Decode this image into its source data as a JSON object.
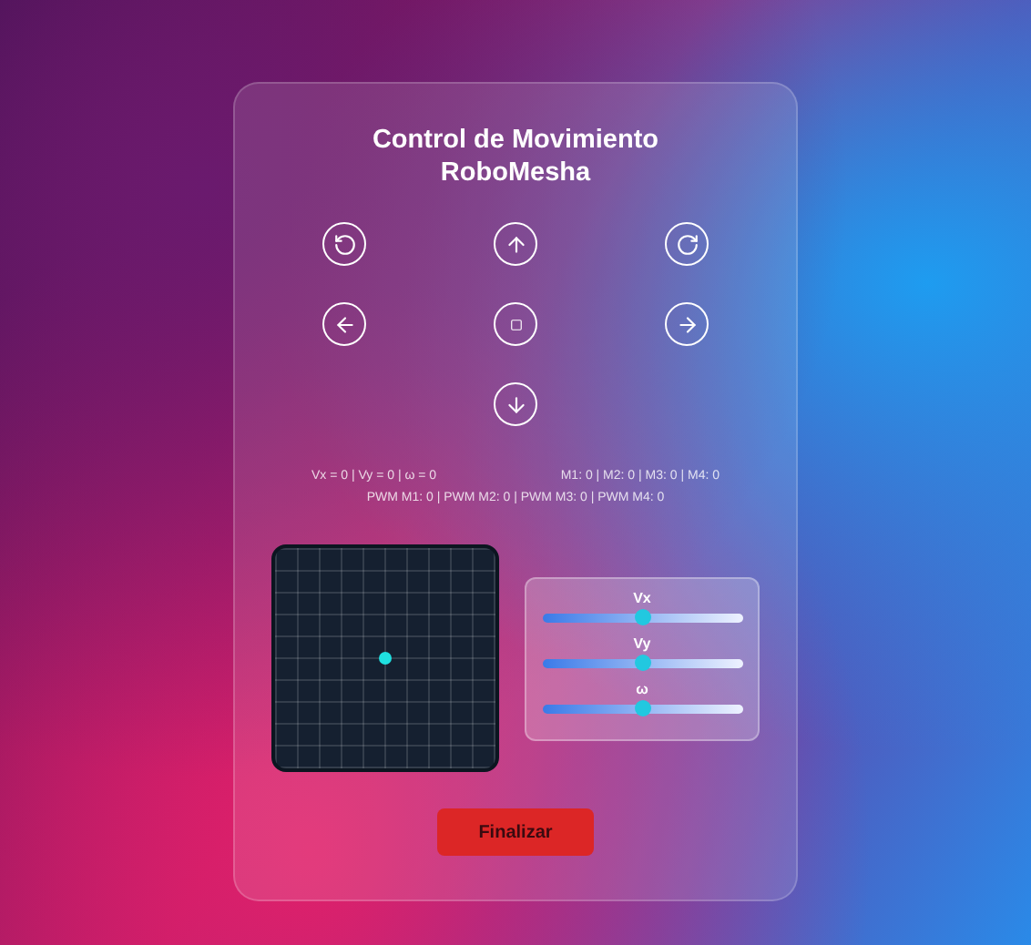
{
  "title": [
    "Control de Movimiento",
    "RoboMesha"
  ],
  "controls": [
    {
      "kind": "rotate-left"
    },
    {
      "kind": "up"
    },
    {
      "kind": "rotate-right"
    },
    {
      "kind": "left"
    },
    {
      "kind": "stop"
    },
    {
      "kind": "right"
    },
    {
      "kind": "empty"
    },
    {
      "kind": "down"
    },
    {
      "kind": "empty"
    }
  ],
  "readouts": {
    "velocity": "Vx = 0 | Vy = 0 | ω = 0",
    "motors": "M1: 0 | M2: 0 | M3: 0 | M4: 0",
    "pwm": "PWM M1: 0 | PWM M2: 0 | PWM M3: 0 | PWM M4: 0"
  },
  "sliders": [
    {
      "label": "Vx",
      "level": 0.5
    },
    {
      "label": "Vy",
      "level": 0.5
    },
    {
      "label": "ω",
      "level": 0.5
    }
  ],
  "finish_button": "Finalizar"
}
